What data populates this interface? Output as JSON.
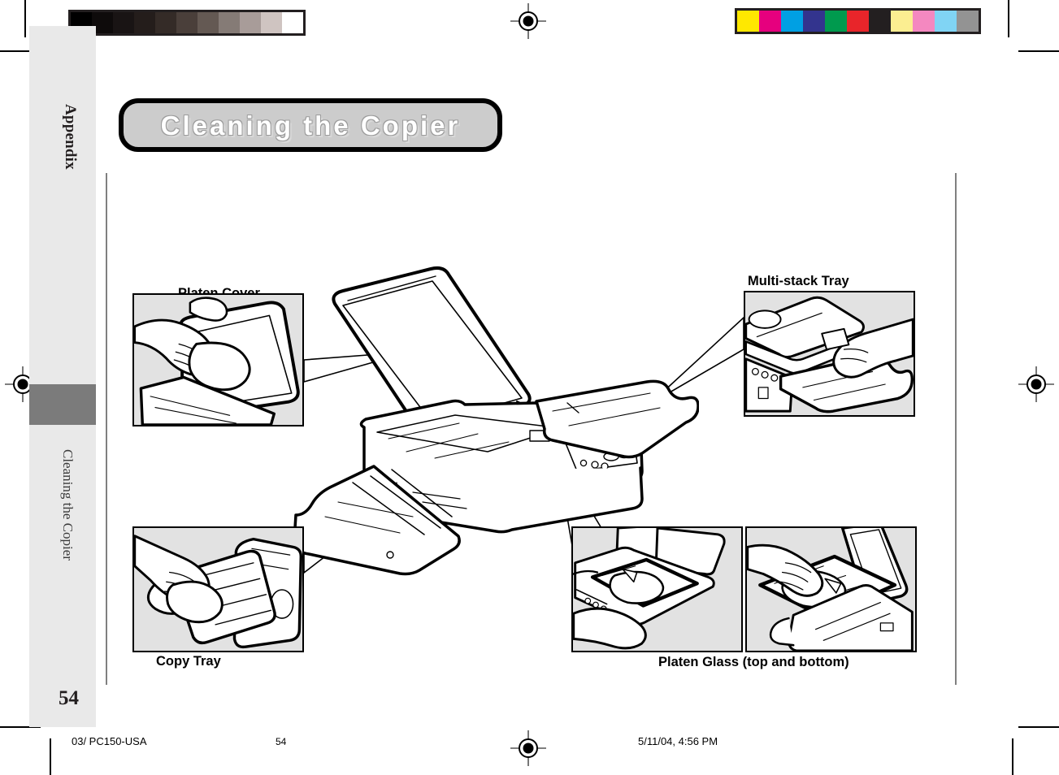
{
  "document": {
    "title": "Cleaning the Copier",
    "page_number": "54",
    "sidebar": {
      "chapter_label": "Appendix",
      "section_label": "Cleaning the Copier"
    },
    "footer": {
      "doc_id": "03/ PC150-USA",
      "page": "54",
      "timestamp": "5/11/04, 4:56 PM"
    }
  },
  "callouts": [
    {
      "id": "platen-cover",
      "label": "Platen Cover",
      "position": "above"
    },
    {
      "id": "multi-stack-tray",
      "label": "Multi-stack Tray",
      "position": "above"
    },
    {
      "id": "copy-tray",
      "label": "Copy Tray",
      "position": "below"
    },
    {
      "id": "platen-glass",
      "label": "Platen Glass (top and bottom)",
      "position": "below"
    }
  ],
  "print_marks": {
    "gray_strip": [
      "#000000",
      "#0e0b0b",
      "#191414",
      "#241d1b",
      "#342b27",
      "#4a3f3a",
      "#645953",
      "#857b76",
      "#a89c99",
      "#cfc4c1",
      "#ffffff"
    ],
    "color_strip": [
      "#ffe800",
      "#e6007e",
      "#00a0e3",
      "#33348e",
      "#009a4e",
      "#e8252a",
      "#231f20",
      "#fbee91",
      "#f488c0",
      "#80d4f4",
      "#939393"
    ],
    "registration_mark": "registration-target"
  },
  "colors": {
    "sidebar": "#e9e9e9",
    "tab_block": "#7b7b7b",
    "banner_fill": "#cccccc",
    "panel_fill": "#e2e2e2",
    "rule": "#808080",
    "ink": "#000000"
  }
}
